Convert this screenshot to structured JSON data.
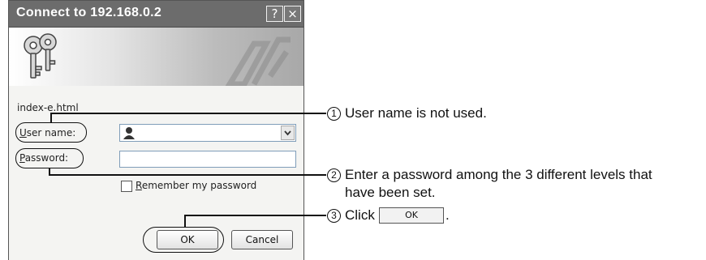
{
  "dialog": {
    "title": "Connect to 192.168.0.2",
    "help_label": "?",
    "close_label": "×",
    "resource": "index-e.html",
    "username_label": "User name:",
    "password_label": "Password:",
    "username_value": "",
    "password_value": "",
    "remember_label": "Remember my password",
    "remember_checked": false,
    "ok_label": "OK",
    "cancel_label": "Cancel"
  },
  "annotations": [
    {
      "number": "1",
      "text": "User name is not used."
    },
    {
      "number": "2",
      "text": "Enter a password among the 3 different levels that",
      "text2": "have been set."
    },
    {
      "number": "3",
      "text": "Click",
      "button_label": "OK",
      "suffix": "."
    }
  ]
}
